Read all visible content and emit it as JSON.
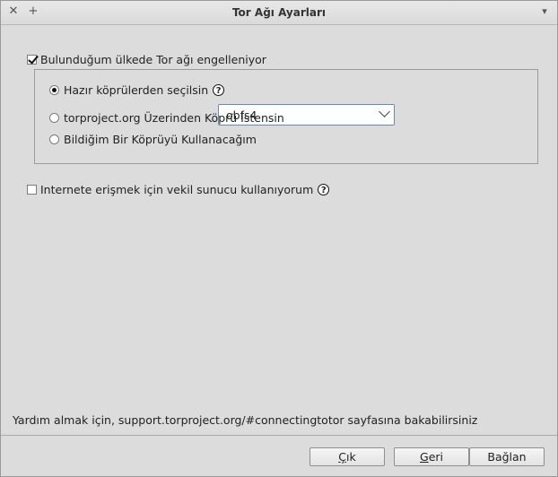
{
  "window": {
    "title": "Tor Ağı Ayarları"
  },
  "titlebar": {
    "close_glyph": "✕",
    "pin_glyph": "+",
    "menu_glyph": "▾"
  },
  "settings": {
    "blocked_checkbox": {
      "label": "Bulunduğum ülkede Tor ağı engelleniyor",
      "checked": true
    },
    "bridge_options": [
      {
        "label": "Hazır köprülerden seçilsin",
        "selected": true
      },
      {
        "label": "torproject.org Üzerinden Köprü İstensin",
        "selected": false
      },
      {
        "label": "Bildiğim Bir Köprüyü Kullanacağım",
        "selected": false
      }
    ],
    "bridge_type": {
      "value": "obfs4"
    },
    "proxy_checkbox": {
      "label": "Internete erişmek için vekil sunucu kullanıyorum",
      "checked": false
    },
    "help_glyph": "?"
  },
  "help_text": "Yardım almak için, support.torproject.org/#connectingtotor sayfasına bakabilirsiniz",
  "buttons": {
    "quit": {
      "mnemonic": "Ç",
      "rest": "ık"
    },
    "back": {
      "mnemonic": "G",
      "rest": "eri"
    },
    "connect": {
      "mnemonic": "",
      "rest": "Bağlan"
    }
  }
}
